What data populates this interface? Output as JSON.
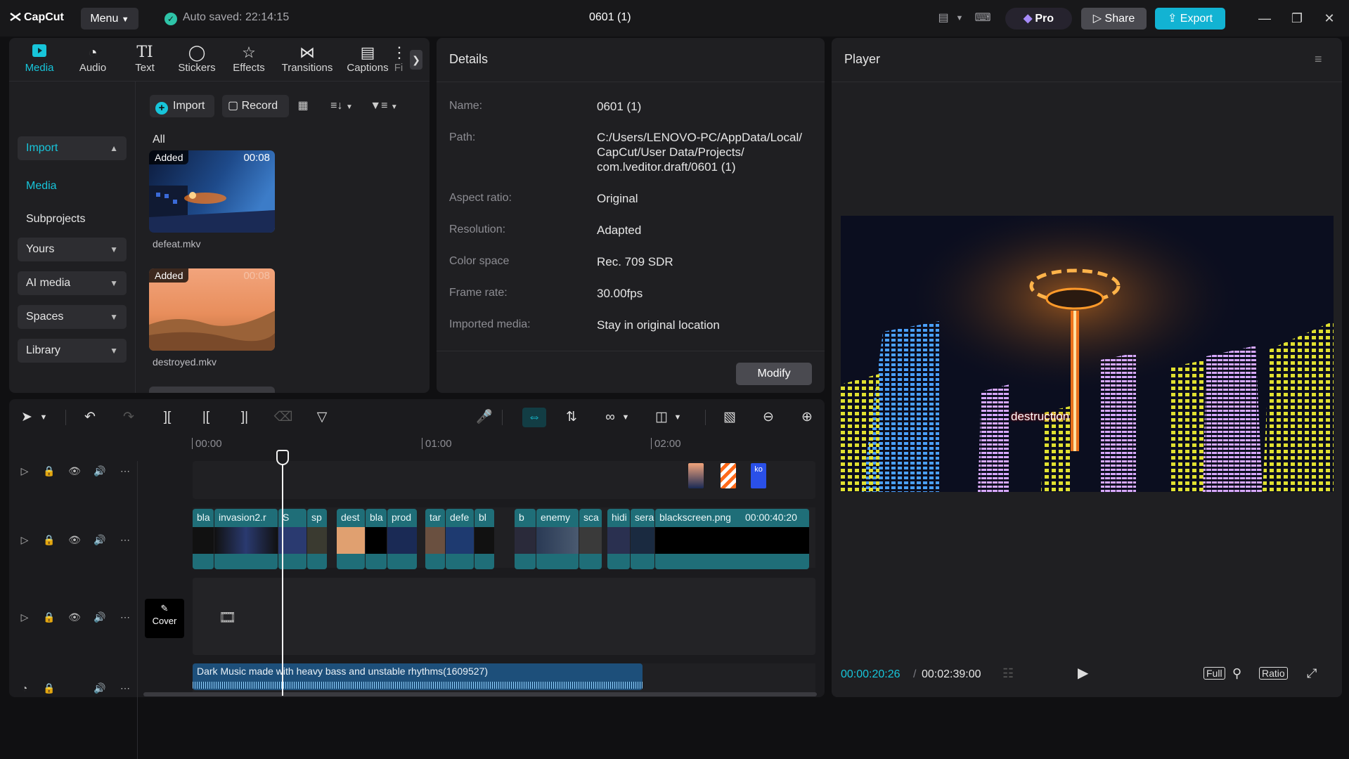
{
  "app": {
    "logo_text": "CapCut",
    "menu_label": "Menu",
    "autosave": "Auto saved: 22:14:15",
    "project_title": "0601 (1)",
    "pro_label": "Pro",
    "share_label": "Share",
    "export_label": "Export"
  },
  "media_tabs": [
    "Media",
    "Audio",
    "Text",
    "Stickers",
    "Effects",
    "Transitions",
    "Captions",
    "Fi"
  ],
  "sidebar": {
    "import": "Import",
    "media": "Media",
    "subprojects": "Subprojects",
    "yours": "Yours",
    "ai_media": "AI media",
    "spaces": "Spaces",
    "library": "Library"
  },
  "media_toolbar": {
    "import": "Import",
    "record": "Record"
  },
  "media_list": {
    "filter_label": "All",
    "items": [
      {
        "name": "defeat.mkv",
        "badge": "Added",
        "duration": "00:08"
      },
      {
        "name": "destroyed.mkv",
        "badge": "Added",
        "duration": "00:08"
      }
    ]
  },
  "details": {
    "title": "Details",
    "rows": [
      {
        "label": "Name:",
        "value": "0601 (1)"
      },
      {
        "label": "Path:",
        "value": "C:/Users/LENOVO-PC/AppData/Local/ CapCut/User Data/Projects/ com.lveditor.draft/0601 (1)"
      },
      {
        "label": "Aspect ratio:",
        "value": "Original"
      },
      {
        "label": "Resolution:",
        "value": "Adapted"
      },
      {
        "label": "Color space",
        "value": "Rec. 709 SDR"
      },
      {
        "label": "Frame rate:",
        "value": "30.00fps"
      },
      {
        "label": "Imported media:",
        "value": "Stay in original location"
      }
    ],
    "modify_label": "Modify"
  },
  "player": {
    "title": "Player",
    "caption": "destruction",
    "current_time": "00:00:20:26",
    "separator": "/",
    "total_time": "00:02:39:00",
    "full_label": "Full",
    "ratio_label": "Ratio"
  },
  "timeline": {
    "ruler": [
      "00:00",
      "01:00",
      "02:00"
    ],
    "main_clips": [
      "bla",
      "invasion2.r",
      "S",
      "sp",
      "dest",
      "bla",
      "prod",
      "tar",
      "defe",
      "bl",
      "b",
      "enemy",
      "sca",
      "hidi",
      "sera",
      "blackscreen.png",
      "00:00:40:20"
    ],
    "cover_label": "Cover",
    "overlay_clip_text": "ko",
    "audio_clip": "Dark Music made with heavy bass and unstable rhythms(1609527)"
  },
  "colors": {
    "accent": "#17c5da",
    "clip": "#1f6e78",
    "audio_clip": "#1d4f7a",
    "export": "#12b3d3"
  }
}
